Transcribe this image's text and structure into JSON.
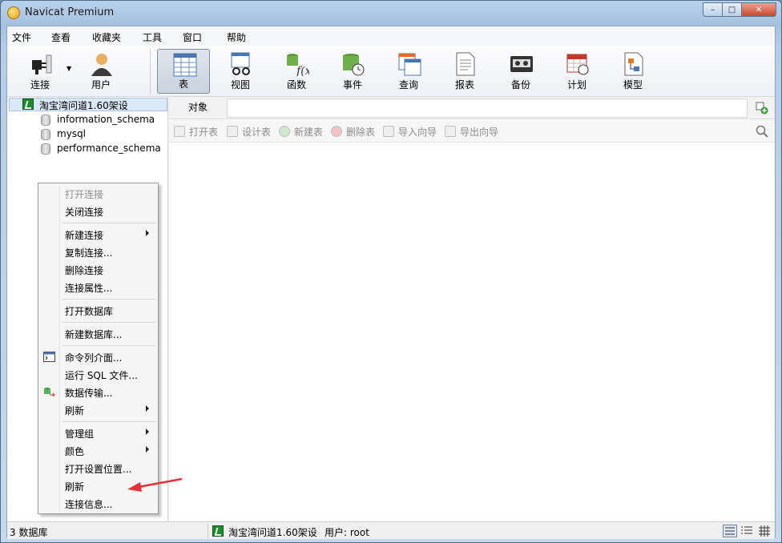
{
  "window": {
    "title": "Navicat Premium",
    "buttons": [
      "–",
      "□",
      "✕"
    ]
  },
  "menu": [
    "文件",
    "查看",
    "收藏夹",
    "工具",
    "窗口",
    "帮助"
  ],
  "toolbar": {
    "connect": "连接",
    "user": "用户",
    "items": [
      "表",
      "视图",
      "函数",
      "事件",
      "查询",
      "报表",
      "备份",
      "计划",
      "模型"
    ],
    "active": "表"
  },
  "tree": {
    "connection": "淘宝湾问道1.60架设",
    "databases": [
      "information_schema",
      "mysql",
      "performance_schema"
    ]
  },
  "objects": {
    "tab": "对象",
    "actions": [
      "打开表",
      "设计表",
      "新建表",
      "删除表",
      "导入向导",
      "导出向导"
    ]
  },
  "context_menu": {
    "groups": [
      [
        "打开连接",
        "关闭连接"
      ],
      [
        "新建连接",
        "复制连接...",
        "删除连接",
        "连接属性..."
      ],
      [
        "打开数据库"
      ],
      [
        "新建数据库..."
      ],
      [
        "命令列介面...",
        "运行 SQL 文件...",
        "数据传输...",
        "刷新"
      ],
      [
        "管理组",
        "颜色",
        "打开设置位置...",
        "刷新",
        "连接信息..."
      ]
    ],
    "disabled": [
      "打开连接"
    ]
  },
  "status": {
    "db_count": "3 数据库",
    "connection": "淘宝湾问道1.60架设",
    "user": "用户: root"
  },
  "colors": {
    "accent": "#1e8c2c",
    "annotation_arrow": "#e8303a"
  }
}
